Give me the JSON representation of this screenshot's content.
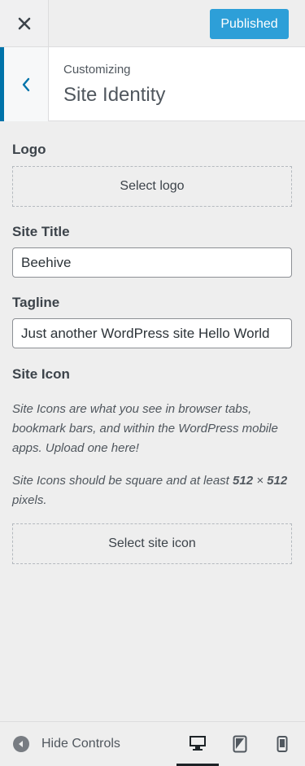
{
  "header": {
    "close_label": "Close",
    "publish_label": "Published"
  },
  "section": {
    "crumb": "Customizing",
    "title": "Site Identity"
  },
  "logo": {
    "label": "Logo",
    "button": "Select logo"
  },
  "site_title": {
    "label": "Site Title",
    "value": "Beehive"
  },
  "tagline": {
    "label": "Tagline",
    "value": "Just another WordPress site Hello World"
  },
  "site_icon": {
    "label": "Site Icon",
    "desc1": "Site Icons are what you see in browser tabs, bookmark bars, and within the WordPress mobile apps. Upload one here!",
    "desc2_prefix": "Site Icons should be square and at least ",
    "desc2_size_a": "512",
    "desc2_times": " × ",
    "desc2_size_b": "512",
    "desc2_suffix": " pixels.",
    "button": "Select site icon"
  },
  "footer": {
    "hide_label": "Hide Controls",
    "devices": [
      "desktop",
      "tablet",
      "mobile"
    ],
    "active_device": "desktop"
  },
  "colors": {
    "accent": "#0073aa",
    "publish_bg": "#2d9fd8",
    "panel_bg": "#eeeeee"
  }
}
